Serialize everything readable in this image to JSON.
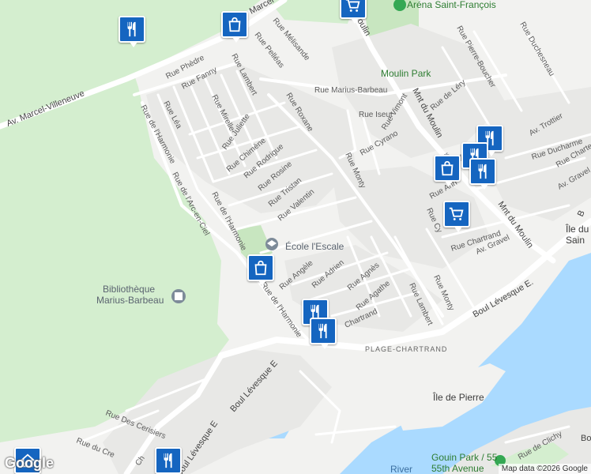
{
  "map": {
    "attribution": "Map data ©2026 Google",
    "logo": "Google",
    "colors": {
      "land": "#f2f2f0",
      "park": "#d4eecf",
      "water": "#aadaff",
      "road": "#ffffff",
      "blocks": "#e8e8e6"
    }
  },
  "poi_labels": {
    "arena": "Aréna Saint-François",
    "moulin_park": "Moulin Park",
    "ecole_escale": "École l'Escale",
    "bibliotheque_1": "Bibliothèque",
    "bibliotheque_2": "Marius-Barbeau",
    "ecole_partial": "École F",
    "ile_de_pierre": "Île de Pierre",
    "ile_du_1": "Île du",
    "ile_du_2": "Sain",
    "gouin_1": "Gouin Park / 55",
    "gouin_2": "55th Avenue",
    "plage": "PLAGE-CHARTRAND",
    "river": "River"
  },
  "streets": {
    "av_marcel_villeneuve": "Av. Marcel-Villeneuve",
    "marcel_top": "Marcel-",
    "rue_melisande": "Rue Mélisande",
    "rue_pelleas": "Rue Pelléas",
    "rue_phedre": "Rue Phèdre",
    "rue_fanny": "Rue Fanny",
    "rue_lambert_top": "Rue Lambert",
    "rue_lea": "Rue Léa",
    "rue_mirelle": "Rue Mirelle",
    "rue_juliette": "Rue Juliette",
    "rue_chimene": "Rue Chimène",
    "rue_rodrigue": "Rue Rodrigue",
    "rue_rosine": "Rue Rosine",
    "rue_tristan": "Rue Tristan",
    "rue_valentin": "Rue Valentin",
    "rue_roxane": "Rue Roxane",
    "rue_marius_barbeau": "Rue Marius-Barbeau",
    "rue_iseut": "Rue Iseut",
    "rue_vimont": "Rue Vimont",
    "rue_cyrano": "Rue Cyrano",
    "rue_monty_1": "Rue Monty",
    "rue_monty_2": "Rue Monty",
    "rue_de_lharmonie_1": "Rue de l'Harmonie",
    "rue_de_lharmonie_2": "Rue de l'Harmonie",
    "rue_de_lharmonie_3": "Rue de l'Harmonie",
    "rue_arc_en_ciel": "Rue de l'Arc-en-Ciel",
    "rue_angele": "Rue Angèle",
    "rue_adrien": "Rue Adrien",
    "rue_agnes": "Rue Agnès",
    "rue_agathe": "Rue Agathe",
    "rue_lambert_2": "Rue Lambert",
    "rue_chartrand_1": "Chartrand",
    "rue_chartrand_2": "Rue Chartrand",
    "mnt_du_moulin_1": "Mnt du Moulin",
    "mnt_du_moulin_2": "Mnt du Moulin",
    "moulin_top": "oulin",
    "rue_pierre_boucher": "Rue Pierre-Boucher",
    "rue_de_lery": "Rue de Léry",
    "rue_duchesneau": "Rue Duchesneau",
    "rue_therien": "Rue Thérien",
    "av_trottier": "Av. Trottier",
    "rue_ducharme": "Rue Ducharme",
    "rue_chartier": "Rue Charte",
    "av_gravel_1": "Av. Gravel",
    "av_gravel_2": "Av. Gravel",
    "rue_ann": "Rue Ann",
    "rue_cy": "Rue Cy",
    "boul_levesque_1": "Boul Lévesque E.",
    "boul_levesque_2": "Boul Lévesque E",
    "boul_levesque_3": "Boul Lévesque E",
    "rue_des_cerisiers": "Rue Des Cerisiers",
    "rue_du_cre": "Rue du Cre",
    "ch_partial": "Ch",
    "rue_de_clichy": "Rue de Clichy",
    "b_right": "B",
    "bo_right": "Bo"
  },
  "markers": [
    {
      "type": "restaurant-icon"
    },
    {
      "type": "shopping-bag-icon"
    },
    {
      "type": "shopping-cart-icon"
    },
    {
      "type": "shopping-bag-icon"
    },
    {
      "type": "restaurant-icon"
    },
    {
      "type": "shopping-bag-icon"
    },
    {
      "type": "restaurant-icon"
    },
    {
      "type": "shopping-cart-icon"
    },
    {
      "type": "restaurant-icon"
    },
    {
      "type": "restaurant-icon"
    },
    {
      "type": "restaurant-icon"
    },
    {
      "type": "home-icon"
    }
  ]
}
